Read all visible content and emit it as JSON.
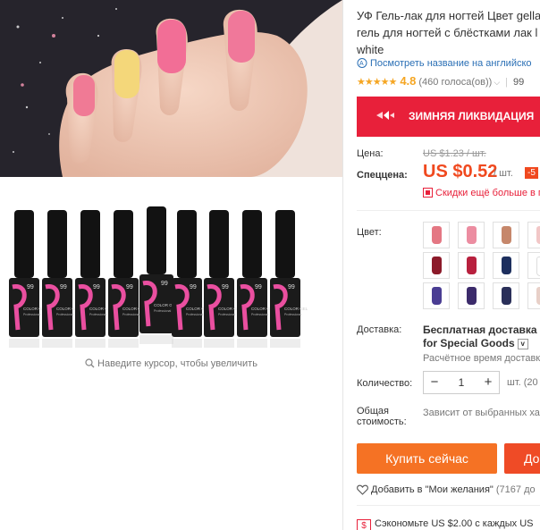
{
  "gallery": {
    "zoom_hint": "Наведите курсор, чтобы увеличить",
    "bottle_brand": "99",
    "bottle_text": "COLOR GEL",
    "bottle_sub": "Professional"
  },
  "product": {
    "title_lines": [
      "УФ Гель-лак для ногтей Цвет gella",
      "гель для ногтей с блёстками лак l",
      "white"
    ],
    "translate_link": "Посмотреть название на английско",
    "rating_stars": "★★★★★",
    "rating_value": "4.8",
    "votes": "(460 голоса(ов))",
    "sold_prefix": "99"
  },
  "promo": {
    "text": "ЗИМНЯЯ ЛИКВИДАЦИЯ",
    "color": "#e8203a"
  },
  "price": {
    "label": "Цена:",
    "old": "US $1.23 / шт.",
    "sale_label": "Спеццена:",
    "current": "US $0.52",
    "unit": "/ шт.",
    "discount_badge": "-5",
    "coupon_text": "Скидки ещё больше в п",
    "accent_color": "#f0491f"
  },
  "color_selector": {
    "label": "Цвет:",
    "swatch_colors": [
      "#e47783",
      "#ec8da1",
      "#c6876b",
      "#f2c7c7",
      "#8c1a2a",
      "#b8203e",
      "#1d2f5e",
      "#ffffff",
      "#4a3d93",
      "#3c2b6b",
      "#2a2f59",
      "#e8d0c8"
    ]
  },
  "shipping": {
    "label": "Доставка:",
    "title": "Бесплатная доставка в R",
    "subtitle": "for Special Goods",
    "time": "Расчётное время доставки"
  },
  "quantity": {
    "label": "Количество:",
    "value": "1",
    "unit": "шт. (20"
  },
  "total": {
    "label_1": "Общая",
    "label_2": "стоимость:",
    "value": "Зависит от выбранных хар"
  },
  "actions": {
    "buy_now": "Купить сейчас",
    "add_to_cart": "До",
    "wishlist": "Добавить в \"Мои желания\"",
    "wishlist_count": "(7167 до"
  },
  "savings": {
    "text": "Сэкономьте US $2.00 с каждых US"
  }
}
